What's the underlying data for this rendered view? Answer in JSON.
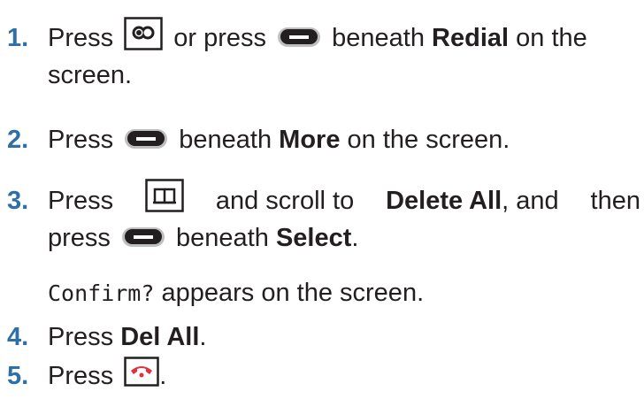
{
  "steps": [
    {
      "number": "1.",
      "parts": {
        "press": "Press",
        "or_press": "or press",
        "beneath": "beneath",
        "softkey_label": "Redial",
        "on_the": "on the",
        "screen": "screen."
      }
    },
    {
      "number": "2.",
      "parts": {
        "press": "Press",
        "beneath": "beneath",
        "softkey_label": "More",
        "rest": "on the screen."
      }
    },
    {
      "number": "3.",
      "parts": {
        "press": "Press",
        "and_scroll_to": "and scroll to",
        "option": "Delete All",
        "and": ", and",
        "then": "then",
        "press2": "press",
        "beneath": "beneath",
        "softkey_label": "Select",
        "period": "."
      },
      "note": {
        "screen_text": "Confirm?",
        "rest": "appears on the screen."
      }
    },
    {
      "number": "4.",
      "parts": {
        "press": "Press",
        "softkey_label": "Del All",
        "period": "."
      }
    },
    {
      "number": "5.",
      "parts": {
        "press": "Press",
        "period": "."
      }
    }
  ],
  "icons": {
    "redial_key": "redial-key-icon",
    "soft_key": "soft-key-icon",
    "phonebook_key": "phonebook-key-icon",
    "end_call_key": "end-call-key-icon"
  },
  "colors": {
    "step_number": "#2f6fa8",
    "text": "#231f20",
    "end_call": "#e0323a"
  }
}
